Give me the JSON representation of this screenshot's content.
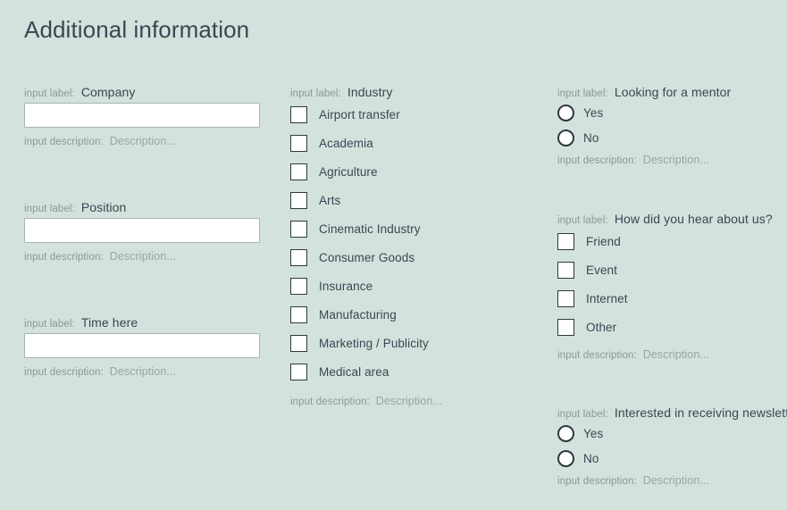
{
  "page": {
    "title": "Additional information",
    "background_color": "#d3e2dc",
    "text_color": "#3c4653",
    "muted_color": "#8c9895"
  },
  "common": {
    "label_prefix": "input label:",
    "description_prefix": "input description:",
    "description_value": "Description..."
  },
  "columns": {
    "left": {
      "fields": [
        {
          "label": "Company",
          "value": "",
          "placeholder": ""
        },
        {
          "label": "Position",
          "value": "",
          "placeholder": ""
        },
        {
          "label": "Time here",
          "value": "",
          "placeholder": ""
        }
      ]
    },
    "middle": {
      "industry": {
        "label": "Industry",
        "options": [
          "Airport transfer",
          "Academia",
          "Agriculture",
          "Arts",
          "Cinematic Industry",
          "Consumer Goods",
          "Insurance",
          "Manufacturing",
          "Marketing / Publicity",
          "Medical area"
        ]
      }
    },
    "right": {
      "mentor": {
        "label": "Looking for a mentor",
        "options": [
          "Yes",
          "No"
        ]
      },
      "hear_about_us": {
        "label": "How did you hear about us?",
        "options": [
          "Friend",
          "Event",
          "Internet",
          "Other"
        ]
      },
      "newsletter": {
        "label": "Interested in receiving newsletter",
        "options": [
          "Yes",
          "No"
        ]
      }
    }
  }
}
